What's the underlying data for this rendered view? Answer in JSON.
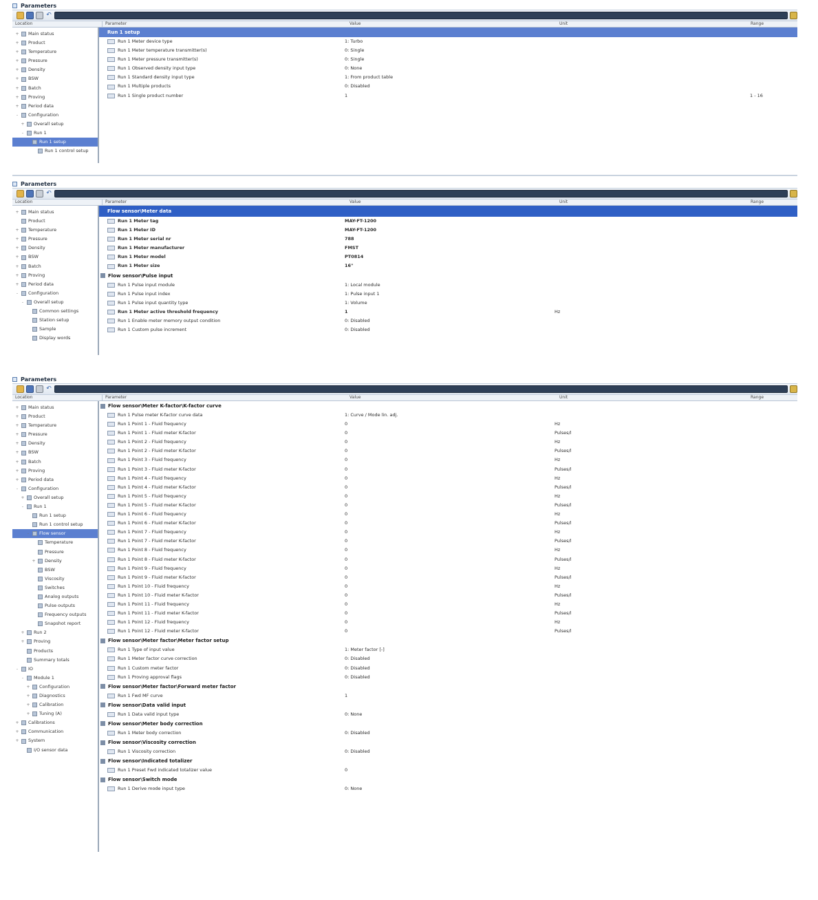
{
  "panels": [
    {
      "title": "Parameters",
      "headers": {
        "location": "Location",
        "parameter": "Parameter",
        "value": "Value",
        "unit": "Unit",
        "range": "Range"
      },
      "tree": [
        {
          "label": "Main status",
          "icon": "monitor-icon",
          "exp": "+"
        },
        {
          "label": "Product",
          "icon": "bottle-icon",
          "exp": "+"
        },
        {
          "label": "Temperature",
          "icon": "thermometer-icon",
          "exp": "+"
        },
        {
          "label": "Pressure",
          "icon": "gauge-icon",
          "exp": "+"
        },
        {
          "label": "Density",
          "icon": "flask-icon",
          "exp": "+"
        },
        {
          "label": "BSW",
          "icon": "drop-icon",
          "exp": "+"
        },
        {
          "label": "Batch",
          "icon": "batch-icon",
          "exp": "+"
        },
        {
          "label": "Proving",
          "icon": "prover-icon",
          "exp": "+"
        },
        {
          "label": "Period data",
          "icon": "calendar-icon",
          "exp": "+"
        },
        {
          "label": "Configuration",
          "icon": "wrench-icon",
          "exp": "-"
        },
        {
          "label": "Overall setup",
          "icon": "wrench-icon",
          "exp": "+"
        },
        {
          "label": "Run 1",
          "icon": "run-icon",
          "exp": "-"
        },
        {
          "label": "Run 1 setup",
          "icon": "page-icon",
          "exp": "",
          "sel": true
        },
        {
          "label": "Run 1 control setup",
          "icon": "page-icon",
          "exp": ""
        }
      ],
      "banner": "Run 1 setup",
      "groups": [
        {
          "label": "",
          "rows": [
            {
              "param": "Run 1 Meter device type",
              "value": "1: Turbo",
              "unit": "",
              "range": ""
            },
            {
              "param": "Run 1 Meter temperature transmitter(s)",
              "value": "0: Single",
              "unit": "",
              "range": ""
            },
            {
              "param": "Run 1 Meter pressure transmitter(s)",
              "value": "0: Single",
              "unit": "",
              "range": ""
            },
            {
              "param": "Run 1 Observed density input type",
              "value": "0: None",
              "unit": "",
              "range": ""
            },
            {
              "param": "Run 1 Standard density input type",
              "value": "1: From product table",
              "unit": "",
              "range": ""
            },
            {
              "param": "Run 1 Multiple products",
              "value": "0: Disabled",
              "unit": "",
              "range": ""
            },
            {
              "param": "Run 1 Single product number",
              "value": "1",
              "unit": "",
              "range": "1 - 16"
            }
          ]
        }
      ]
    },
    {
      "title": "Parameters",
      "headers": {
        "location": "Location",
        "parameter": "Parameter",
        "value": "Value",
        "unit": "Unit",
        "range": "Range"
      },
      "tree": [
        {
          "label": "Main status",
          "icon": "monitor-icon",
          "exp": "+"
        },
        {
          "label": "Product",
          "icon": "bottle-icon",
          "exp": ""
        },
        {
          "label": "Temperature",
          "icon": "thermometer-icon",
          "exp": "+"
        },
        {
          "label": "Pressure",
          "icon": "gauge-icon",
          "exp": "+"
        },
        {
          "label": "Density",
          "icon": "flask-icon",
          "exp": "+"
        },
        {
          "label": "BSW",
          "icon": "drop-icon",
          "exp": "+"
        },
        {
          "label": "Batch",
          "icon": "batch-icon",
          "exp": "+"
        },
        {
          "label": "Proving",
          "icon": "prover-icon",
          "exp": "+"
        },
        {
          "label": "Period data",
          "icon": "calendar-icon",
          "exp": "+"
        },
        {
          "label": "Configuration",
          "icon": "wrench-icon",
          "exp": "-"
        },
        {
          "label": "Overall setup",
          "icon": "wrench-icon",
          "exp": "-"
        },
        {
          "label": "Common settings",
          "icon": "page-icon",
          "exp": ""
        },
        {
          "label": "Station setup",
          "icon": "page-icon",
          "exp": ""
        },
        {
          "label": "Sample",
          "icon": "page-icon",
          "exp": ""
        },
        {
          "label": "Display words",
          "icon": "page-icon",
          "exp": ""
        }
      ],
      "banner": "Flow sensor\\Meter data",
      "groups": [
        {
          "label": "",
          "rows": [
            {
              "param": "Run 1 Meter tag",
              "value": "MAY-FT-1200",
              "unit": "",
              "range": "",
              "bold": true
            },
            {
              "param": "Run 1 Meter ID",
              "value": "MAY-FT-1200",
              "unit": "",
              "range": "",
              "bold": true
            },
            {
              "param": "Run 1 Meter serial nr",
              "value": "788",
              "unit": "",
              "range": "",
              "bold": true
            },
            {
              "param": "Run 1 Meter manufacturer",
              "value": "FMST",
              "unit": "",
              "range": "",
              "bold": true
            },
            {
              "param": "Run 1 Meter model",
              "value": "PT0814",
              "unit": "",
              "range": "",
              "bold": true
            },
            {
              "param": "Run 1 Meter size",
              "value": "16\"",
              "unit": "",
              "range": "",
              "bold": true
            }
          ]
        },
        {
          "label": "Flow sensor\\Pulse input",
          "rows": [
            {
              "param": "Run 1 Pulse input module",
              "value": "1: Local module",
              "unit": "",
              "range": ""
            },
            {
              "param": "Run 1 Pulse input index",
              "value": "1: Pulse input 1",
              "unit": "",
              "range": ""
            },
            {
              "param": "Run 1 Pulse input quantity type",
              "value": "1: Volume",
              "unit": "",
              "range": ""
            },
            {
              "param": "Run 1 Meter active threshold frequency",
              "value": "1",
              "unit": "Hz",
              "range": "",
              "bold": true
            },
            {
              "param": "Run 1 Enable meter memory output condition",
              "value": "0: Disabled",
              "unit": "",
              "range": ""
            },
            {
              "param": "Run 1 Custom pulse increment",
              "value": "0: Disabled",
              "unit": "",
              "range": ""
            }
          ]
        }
      ]
    },
    {
      "title": "Parameters",
      "headers": {
        "location": "Location",
        "parameter": "Parameter",
        "value": "Value",
        "unit": "Unit",
        "range": "Range"
      },
      "tree": [
        {
          "label": "Main status",
          "icon": "monitor-icon",
          "exp": "+"
        },
        {
          "label": "Product",
          "icon": "bottle-icon",
          "exp": "+"
        },
        {
          "label": "Temperature",
          "icon": "thermometer-icon",
          "exp": "+"
        },
        {
          "label": "Pressure",
          "icon": "gauge-icon",
          "exp": "+"
        },
        {
          "label": "Density",
          "icon": "flask-icon",
          "exp": "+"
        },
        {
          "label": "BSW",
          "icon": "drop-icon",
          "exp": "+"
        },
        {
          "label": "Batch",
          "icon": "batch-icon",
          "exp": "+"
        },
        {
          "label": "Proving",
          "icon": "prover-icon",
          "exp": "+"
        },
        {
          "label": "Period data",
          "icon": "calendar-icon",
          "exp": "+"
        },
        {
          "label": "Configuration",
          "icon": "wrench-icon",
          "exp": "-"
        },
        {
          "label": "Overall setup",
          "icon": "wrench-icon",
          "exp": "+"
        },
        {
          "label": "Run 1",
          "icon": "run-icon",
          "exp": "-"
        },
        {
          "label": "Run 1 setup",
          "icon": "page-icon",
          "exp": ""
        },
        {
          "label": "Run 1 control setup",
          "icon": "page-icon",
          "exp": ""
        },
        {
          "label": "Flow sensor",
          "icon": "sensor-icon",
          "exp": "-",
          "sel": true
        },
        {
          "label": "Temperature",
          "icon": "thermometer-icon",
          "exp": ""
        },
        {
          "label": "Pressure",
          "icon": "gauge-icon",
          "exp": ""
        },
        {
          "label": "Density",
          "icon": "flask-icon",
          "exp": "+"
        },
        {
          "label": "BSW",
          "icon": "drop-icon",
          "exp": ""
        },
        {
          "label": "Viscosity",
          "icon": "page-icon",
          "exp": ""
        },
        {
          "label": "Switches",
          "icon": "page-icon",
          "exp": ""
        },
        {
          "label": "Analog outputs",
          "icon": "page-icon",
          "exp": ""
        },
        {
          "label": "Pulse outputs",
          "icon": "page-icon",
          "exp": ""
        },
        {
          "label": "Frequency outputs",
          "icon": "page-icon",
          "exp": ""
        },
        {
          "label": "Snapshot report",
          "icon": "page-icon",
          "exp": ""
        },
        {
          "label": "Run 2",
          "icon": "run-icon",
          "exp": "+"
        },
        {
          "label": "Proving",
          "icon": "prover-icon",
          "exp": "+"
        },
        {
          "label": "Products",
          "icon": "bottle-icon",
          "exp": ""
        },
        {
          "label": "Summary totals",
          "icon": "page-icon",
          "exp": ""
        },
        {
          "label": "IO",
          "icon": "io-icon",
          "exp": "-"
        },
        {
          "label": "Module 1",
          "icon": "module-icon",
          "exp": "-"
        },
        {
          "label": "Configuration",
          "icon": "wrench-icon",
          "exp": "+"
        },
        {
          "label": "Diagnostics",
          "icon": "page-icon",
          "exp": "+"
        },
        {
          "label": "Calibration",
          "icon": "page-icon",
          "exp": "+"
        },
        {
          "label": "Tuning (A)",
          "icon": "page-icon",
          "exp": "+"
        },
        {
          "label": "Calibrations",
          "icon": "page-icon",
          "exp": "+"
        },
        {
          "label": "Communication",
          "icon": "page-icon",
          "exp": "+"
        },
        {
          "label": "System",
          "icon": "page-icon",
          "exp": "+"
        },
        {
          "label": "I/O sensor data",
          "icon": "page-icon",
          "exp": ""
        }
      ],
      "banner": "",
      "groups": [
        {
          "label": "Flow sensor\\Meter K-factor\\K-factor curve",
          "rows": [
            {
              "param": "Run 1 Pulse meter K-factor curve data",
              "value": "1: Curve / Mode lin. adj.",
              "unit": "",
              "range": ""
            },
            {
              "param": "Run 1 Point 1 - Fluid frequency",
              "value": "0",
              "unit": "Hz",
              "range": ""
            },
            {
              "param": "Run 1 Point 1 - Fluid meter K-factor",
              "value": "0",
              "unit": "Pulses/l",
              "range": ""
            },
            {
              "param": "Run 1 Point 2 - Fluid frequency",
              "value": "0",
              "unit": "Hz",
              "range": ""
            },
            {
              "param": "Run 1 Point 2 - Fluid meter K-factor",
              "value": "0",
              "unit": "Pulses/l",
              "range": ""
            },
            {
              "param": "Run 1 Point 3 - Fluid frequency",
              "value": "0",
              "unit": "Hz",
              "range": ""
            },
            {
              "param": "Run 1 Point 3 - Fluid meter K-factor",
              "value": "0",
              "unit": "Pulses/l",
              "range": ""
            },
            {
              "param": "Run 1 Point 4 - Fluid frequency",
              "value": "0",
              "unit": "Hz",
              "range": ""
            },
            {
              "param": "Run 1 Point 4 - Fluid meter K-factor",
              "value": "0",
              "unit": "Pulses/l",
              "range": ""
            },
            {
              "param": "Run 1 Point 5 - Fluid frequency",
              "value": "0",
              "unit": "Hz",
              "range": ""
            },
            {
              "param": "Run 1 Point 5 - Fluid meter K-factor",
              "value": "0",
              "unit": "Pulses/l",
              "range": ""
            },
            {
              "param": "Run 1 Point 6 - Fluid frequency",
              "value": "0",
              "unit": "Hz",
              "range": ""
            },
            {
              "param": "Run 1 Point 6 - Fluid meter K-factor",
              "value": "0",
              "unit": "Pulses/l",
              "range": ""
            },
            {
              "param": "Run 1 Point 7 - Fluid frequency",
              "value": "0",
              "unit": "Hz",
              "range": ""
            },
            {
              "param": "Run 1 Point 7 - Fluid meter K-factor",
              "value": "0",
              "unit": "Pulses/l",
              "range": ""
            },
            {
              "param": "Run 1 Point 8 - Fluid frequency",
              "value": "0",
              "unit": "Hz",
              "range": ""
            },
            {
              "param": "Run 1 Point 8 - Fluid meter K-factor",
              "value": "0",
              "unit": "Pulses/l",
              "range": ""
            },
            {
              "param": "Run 1 Point 9 - Fluid frequency",
              "value": "0",
              "unit": "Hz",
              "range": ""
            },
            {
              "param": "Run 1 Point 9 - Fluid meter K-factor",
              "value": "0",
              "unit": "Pulses/l",
              "range": ""
            },
            {
              "param": "Run 1 Point 10 - Fluid frequency",
              "value": "0",
              "unit": "Hz",
              "range": ""
            },
            {
              "param": "Run 1 Point 10 - Fluid meter K-factor",
              "value": "0",
              "unit": "Pulses/l",
              "range": ""
            },
            {
              "param": "Run 1 Point 11 - Fluid frequency",
              "value": "0",
              "unit": "Hz",
              "range": ""
            },
            {
              "param": "Run 1 Point 11 - Fluid meter K-factor",
              "value": "0",
              "unit": "Pulses/l",
              "range": ""
            },
            {
              "param": "Run 1 Point 12 - Fluid frequency",
              "value": "0",
              "unit": "Hz",
              "range": ""
            },
            {
              "param": "Run 1 Point 12 - Fluid meter K-factor",
              "value": "0",
              "unit": "Pulses/l",
              "range": ""
            }
          ]
        },
        {
          "label": "Flow sensor\\Meter factor\\Meter factor setup",
          "rows": [
            {
              "param": "Run 1 Type of input value",
              "value": "1: Meter factor [-]",
              "unit": "",
              "range": ""
            },
            {
              "param": "Run 1 Meter factor curve correction",
              "value": "0: Disabled",
              "unit": "",
              "range": ""
            },
            {
              "param": "Run 1 Custom meter factor",
              "value": "0: Disabled",
              "unit": "",
              "range": ""
            },
            {
              "param": "Run 1 Proving approval flags",
              "value": "0: Disabled",
              "unit": "",
              "range": ""
            }
          ]
        },
        {
          "label": "Flow sensor\\Meter factor\\Forward meter factor",
          "rows": [
            {
              "param": "Run 1 Fwd MF curve",
              "value": "1",
              "unit": "",
              "range": ""
            }
          ]
        },
        {
          "label": "Flow sensor\\Data valid input",
          "rows": [
            {
              "param": "Run 1 Data valid input type",
              "value": "0: None",
              "unit": "",
              "range": ""
            }
          ]
        },
        {
          "label": "Flow sensor\\Meter body correction",
          "rows": [
            {
              "param": "Run 1 Meter body correction",
              "value": "0: Disabled",
              "unit": "",
              "range": ""
            }
          ]
        },
        {
          "label": "Flow sensor\\Viscosity correction",
          "rows": [
            {
              "param": "Run 1 Viscosity correction",
              "value": "0: Disabled",
              "unit": "",
              "range": ""
            }
          ]
        },
        {
          "label": "Flow sensor\\Indicated totalizer",
          "rows": [
            {
              "param": "Run 1 Preset Fwd indicated totalizer value",
              "value": "0",
              "unit": "",
              "range": ""
            }
          ]
        },
        {
          "label": "Flow sensor\\Switch mode",
          "rows": [
            {
              "param": "Run 1 Derive mode input type",
              "value": "0: None",
              "unit": "",
              "range": ""
            }
          ]
        }
      ]
    }
  ]
}
